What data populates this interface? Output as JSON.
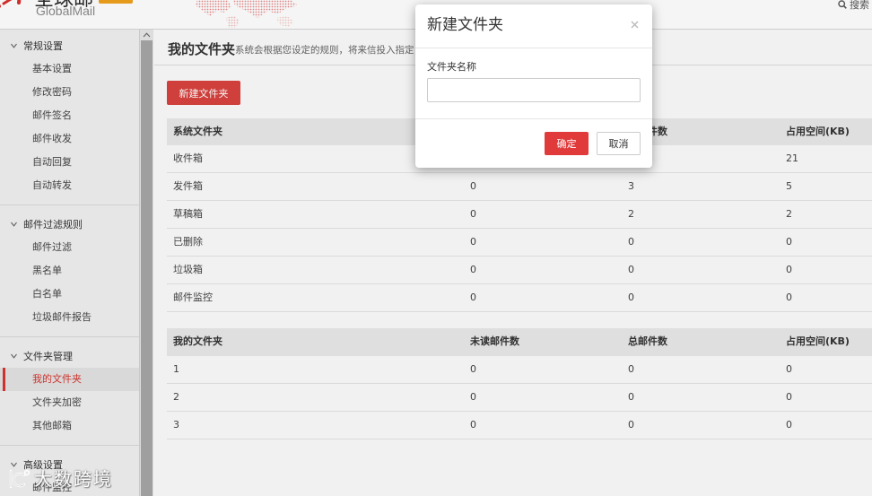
{
  "header": {
    "logo_title": "全球邮",
    "logo_subtitle": "GlobalMail",
    "search_label": "搜索"
  },
  "sidebar": {
    "sections": [
      {
        "title": "常规设置",
        "items": [
          "基本设置",
          "修改密码",
          "邮件签名",
          "邮件收发",
          "自动回复",
          "自动转发"
        ]
      },
      {
        "title": "邮件过滤规则",
        "items": [
          "邮件过滤",
          "黑名单",
          "白名单",
          "垃圾邮件报告"
        ]
      },
      {
        "title": "文件夹管理",
        "items": [
          "我的文件夹",
          "文件夹加密",
          "其他邮箱"
        ]
      },
      {
        "title": "高级设置",
        "items": [
          "邮件监控"
        ]
      }
    ],
    "active": {
      "section": 2,
      "item": 0
    }
  },
  "main": {
    "page_title": "我的文件夹",
    "page_description": "系统会根据您设定的规则，将来信投入指定",
    "new_folder_button": "新建文件夹",
    "system_folders": {
      "columns": [
        "系统文件夹",
        "",
        "总邮件数",
        "占用空间(KB)"
      ],
      "rows": [
        [
          "收件箱",
          "",
          "",
          "21"
        ],
        [
          "发件箱",
          "0",
          "3",
          "5"
        ],
        [
          "草稿箱",
          "0",
          "2",
          "2"
        ],
        [
          "已删除",
          "0",
          "0",
          "0"
        ],
        [
          "垃圾箱",
          "0",
          "0",
          "0"
        ],
        [
          "邮件监控",
          "0",
          "0",
          "0"
        ]
      ]
    },
    "custom_folders": {
      "columns": [
        "我的文件夹",
        "未读邮件数",
        "总邮件数",
        "占用空间(KB)"
      ],
      "rows": [
        [
          "1",
          "0",
          "0",
          "0"
        ],
        [
          "2",
          "0",
          "0",
          "0"
        ],
        [
          "3",
          "0",
          "0",
          "0"
        ]
      ]
    }
  },
  "modal": {
    "title": "新建文件夹",
    "field_label": "文件夹名称",
    "field_value": "",
    "confirm_label": "确定",
    "cancel_label": "取消"
  },
  "watermark": {
    "text": "大数跨境"
  },
  "icons": {
    "logo": "globalmail-logo-icon",
    "search": "search-icon",
    "section_toggle": "chevron-down-icon",
    "scroll_up": "chevron-up-icon",
    "close": "close-icon"
  },
  "colors": {
    "brand_red": "#d8423e",
    "active_red": "#d6352f",
    "confirm_red": "#e03a3b",
    "badge_orange": "#f0a11e",
    "sidebar_bg": "#f0f0f0",
    "table_header_bg": "#e9e9e9"
  }
}
